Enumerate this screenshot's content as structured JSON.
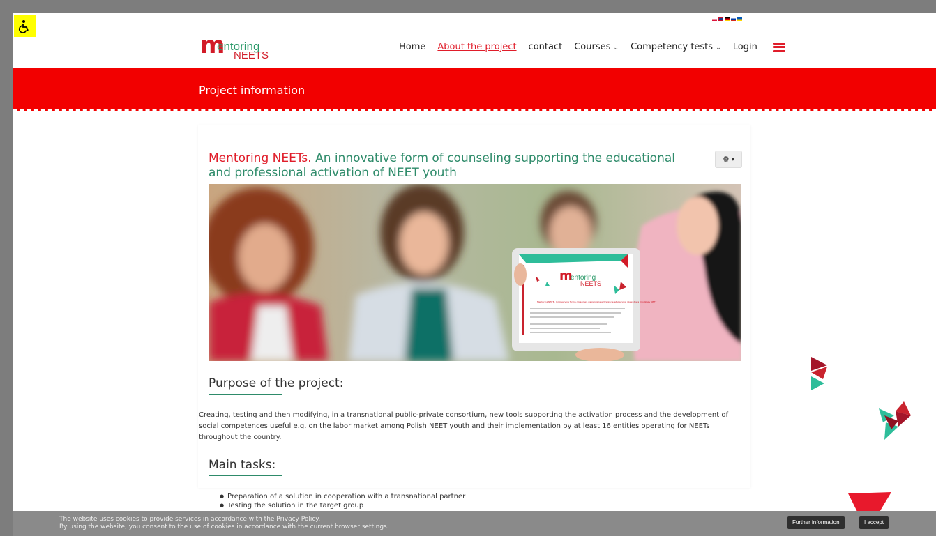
{
  "accessibility": {
    "icon": "wheelchair-icon"
  },
  "language_flags": [
    "pl",
    "gb",
    "de",
    "ru",
    "ua"
  ],
  "logo": {
    "m": "m",
    "line1": "entoring",
    "line2": "NEETS"
  },
  "nav": {
    "items": [
      {
        "label": "Home",
        "active": false
      },
      {
        "label": "About the project",
        "active": true
      },
      {
        "label": "contact",
        "active": false
      },
      {
        "label": "Courses",
        "active": false,
        "dropdown": true
      },
      {
        "label": "Competency tests",
        "active": false,
        "dropdown": true
      },
      {
        "label": "Login",
        "active": false
      }
    ],
    "menu_icon": "hamburger-icon"
  },
  "banner": {
    "title": "Project information"
  },
  "article": {
    "title_red": "Mentoring NEETs.",
    "title_rest": "An innovative form of counseling supporting the educational and professional activation of NEET youth",
    "tools_icon": "gear-icon",
    "tablet_logo_line1": "entoring",
    "tablet_logo_line2": "NEETS",
    "tablet_caption": "Mentoring NEETs. Innowacyjna forma doradztwa wspierająca aktywizację edukacyjną i zawodową młodzieży NEET",
    "purpose_heading": "Purpose of the project:",
    "purpose_text": "Creating, testing and then modifying, in a transnational public-private consortium, new tools supporting the activation process and the development of social competences useful e.g. on the labor market among Polish NEET youth and their implementation by at least 16 entities operating for NEETs throughout the country.",
    "tasks_heading": "Main tasks:",
    "tasks": [
      "Preparation of a solution in cooperation with a transnational partner",
      "Testing the solution in the target group"
    ]
  },
  "cookie": {
    "line1": "The website uses cookies to provide services in accordance with the Privacy Policy.",
    "line2": "By using the website, you consent to the use of cookies in accordance with the current browser settings.",
    "more_label": "Further information",
    "accept_label": "I accept"
  },
  "colors": {
    "brand_red": "#e01d2a",
    "brand_green": "#2e8b6a",
    "banner_red": "#f20000",
    "accessibility_yellow": "#ffff00"
  }
}
